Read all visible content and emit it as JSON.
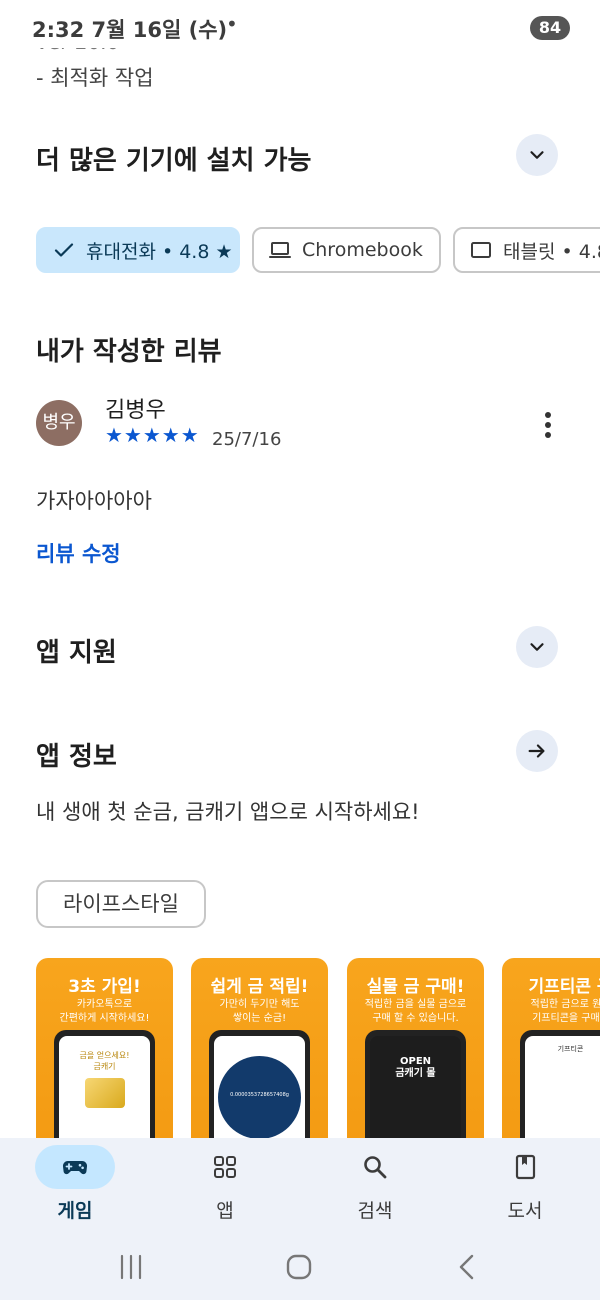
{
  "status_bar": {
    "time": "2:32  7월 16일 (수)",
    "dot": "•",
    "battery": "84"
  },
  "cutoff_text": "ver 20.0",
  "prev_note": "- 최적화 작업",
  "devices_section": {
    "title": "더 많은 기기에 설치 가능",
    "chips": [
      {
        "label": "휴대전화 • 4.8 ★",
        "icon": "check-icon",
        "selected": true
      },
      {
        "label": "Chromebook",
        "icon": "laptop-icon",
        "selected": false
      },
      {
        "label": "태블릿 • 4.8",
        "icon": "tablet-icon",
        "selected": false
      }
    ]
  },
  "my_review": {
    "title": "내가 작성한 리뷰",
    "avatar_text": "병우",
    "author": "김병우",
    "stars": "★★★★★",
    "date": "25/7/16",
    "text": "가자아아아아",
    "edit_label": "리뷰 수정"
  },
  "app_support": {
    "title": "앱 지원"
  },
  "app_info": {
    "title": "앱 정보",
    "description": "내 생애 첫 순금, 금캐기 앱으로 시작하세요!",
    "category": "라이프스타일"
  },
  "screenshots": [
    {
      "title": "3초 가입!",
      "subtitle": "카카오톡으로\n간편하게 시작하세요!",
      "screen_text": "금을 얻으세요!\n금캐기"
    },
    {
      "title": "쉽게 금 적립!",
      "subtitle": "가만히 두기만 해도\n쌓이는 순금!",
      "screen_text": "0.000035372865​7408g"
    },
    {
      "title": "실물 금 구매!",
      "subtitle": "적립한 금을 실물 금으로\n구매 할 수 있습니다.",
      "screen_text": "OPEN\n금캐기 몰"
    },
    {
      "title": "기프티콘 구",
      "subtitle": "적립한 금으로 원하\n기프티콘을 구매하",
      "screen_text": "기프티콘"
    }
  ],
  "bottom_nav": [
    {
      "label": "게임",
      "icon": "gamepad-icon",
      "active": true
    },
    {
      "label": "앱",
      "icon": "apps-grid-icon",
      "active": false
    },
    {
      "label": "검색",
      "icon": "search-icon",
      "active": false
    },
    {
      "label": "도서",
      "icon": "book-icon",
      "active": false
    }
  ],
  "colors": {
    "accent": "#0b57d0",
    "chip_selected": "#c9e7fc",
    "nav_bg": "#eef2f9",
    "shot_orange": "#f8a51d"
  }
}
